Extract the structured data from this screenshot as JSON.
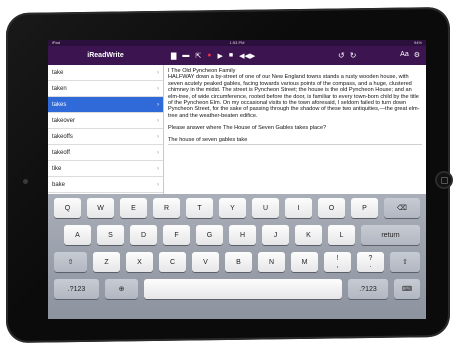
{
  "status_bar": {
    "left": "iPad",
    "center": "1:53 PM",
    "right": "94%"
  },
  "nav": {
    "title": "iReadWrite",
    "font_label": "Aa"
  },
  "word_list": [
    {
      "label": "take",
      "selected": false
    },
    {
      "label": "taken",
      "selected": false
    },
    {
      "label": "takes",
      "selected": true
    },
    {
      "label": "takeover",
      "selected": false
    },
    {
      "label": "takeoffs",
      "selected": false
    },
    {
      "label": "takeoff",
      "selected": false
    },
    {
      "label": "tike",
      "selected": false
    },
    {
      "label": "bake",
      "selected": false
    }
  ],
  "document": {
    "heading": "I The Old Pyncheon Family",
    "body": "HALFWAY down a by-street of one of our New England towns stands a rusty wooden house, with seven acutely peaked gables, facing towards various points of the compass, and a huge, clustered chimney in the midst. The street is Pyncheon Street; the house is the old Pyncheon House; and an elm-tree, of wide circumference, rooted before the door, is familiar to every town-born child by the title of the Pyncheon Elm. On my occasional visits to the town aforesaid, I seldom failed to turn down Pyncheon Street, for the sake of passing through the shadow of these two antiquities,—the great elm-tree and the weather-beaten edifice.",
    "question": "Please answer where The House of Seven Gables takes place?",
    "answer": "The house of seven gables take"
  },
  "keyboard": {
    "row1": [
      "Q",
      "W",
      "E",
      "R",
      "T",
      "Y",
      "U",
      "I",
      "O",
      "P"
    ],
    "row2": [
      "A",
      "S",
      "D",
      "F",
      "G",
      "H",
      "J",
      "K",
      "L"
    ],
    "row2_return": "return",
    "row3": [
      "Z",
      "X",
      "C",
      "V",
      "B",
      "N",
      "M",
      "!",
      ","
    ],
    "row3_extra": [
      "?",
      "."
    ],
    "numbers_label": ".?123"
  }
}
